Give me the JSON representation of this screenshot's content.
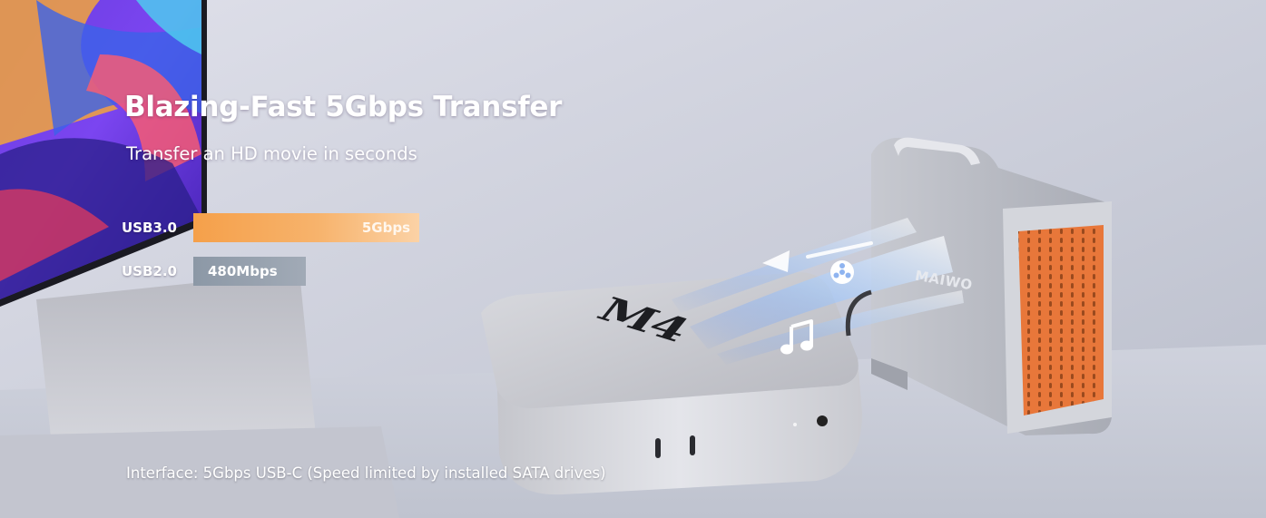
{
  "headline": "Blazing-Fast 5Gbps Transfer",
  "subheadline": "Transfer an HD movie in seconds",
  "speed_comparison": [
    {
      "label": "USB3.0",
      "value": "5Gbps"
    },
    {
      "label": "USB2.0",
      "value": "480Mbps"
    }
  ],
  "footnote": "Interface: 5Gbps USB-C (Speed limited by installed SATA drives)",
  "product_markings": {
    "computer": "M4",
    "enclosure_brand": "MAIWO"
  },
  "icons": [
    "music-note-icon",
    "film-reel-icon",
    "transfer-arrow-icon"
  ],
  "colors": {
    "accent_orange": "#f5a04a",
    "bar_gray": "#8c98a6",
    "enclosure_orange": "#e8773a"
  }
}
